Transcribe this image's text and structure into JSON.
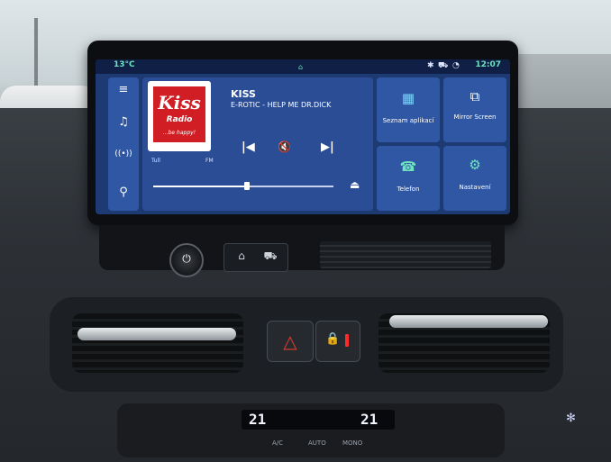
{
  "status": {
    "temperature": "13°C",
    "clock": "12:07"
  },
  "sidebar": {
    "items": [
      {
        "icon": "menu-icon",
        "glyph": "≡"
      },
      {
        "icon": "music-icon",
        "glyph": "♫"
      },
      {
        "icon": "radio-icon",
        "glyph": "((•))"
      },
      {
        "icon": "search-icon",
        "glyph": "⚲"
      }
    ]
  },
  "media": {
    "logo_text": "Kiss",
    "logo_sub": "Radio",
    "logo_tagline": "...be happy!",
    "station": "KISS",
    "track": "E-ROTIC - HELP ME DR.DICK",
    "band_left": "Tull",
    "band_right": "FM",
    "seek_fraction": 0.52
  },
  "tiles": [
    {
      "label": "Seznam aplikací",
      "icon": "apps-grid-icon"
    },
    {
      "label": "Mirror Screen",
      "icon": "mirror-screen-icon"
    },
    {
      "label": "Telefon",
      "icon": "phone-icon"
    },
    {
      "label": "Nastavení",
      "icon": "gear-icon"
    }
  ],
  "climate": {
    "left_temp": "21",
    "right_temp": "21",
    "labels": [
      "A/C",
      "AUTO",
      "MONO"
    ]
  },
  "colors": {
    "accent": "#6fe3c0",
    "tile": "#2f57a3",
    "screen": "#1e3a73"
  }
}
